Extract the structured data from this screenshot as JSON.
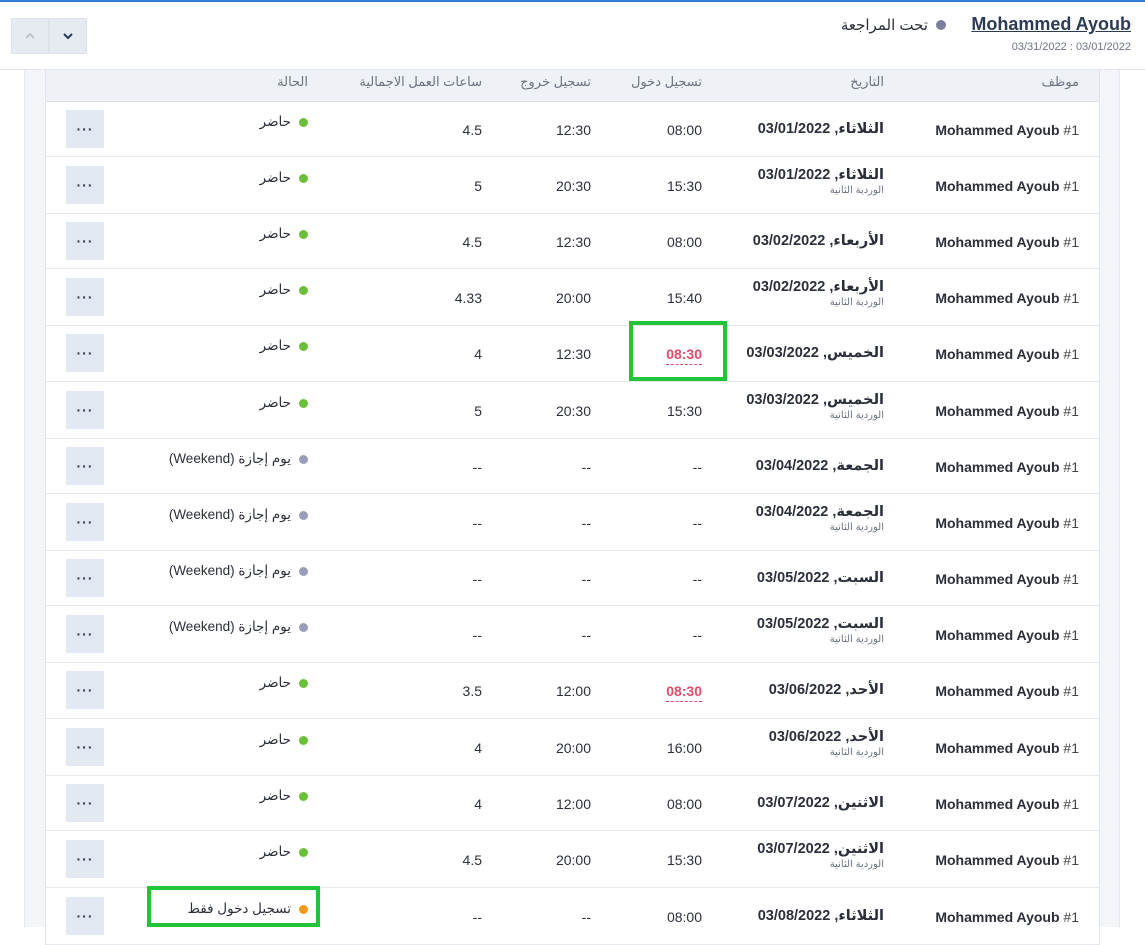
{
  "header": {
    "employee_name": "Mohammed Ayoub",
    "status_label": "تحت المراجعة",
    "date_range": "03/31/2022 : 03/01/2022",
    "status_dot_color": "#7b7f9e"
  },
  "table": {
    "columns": {
      "employee": "موظف",
      "date": "التاريخ",
      "clock_in": "تسجيل دخول",
      "clock_out": "تسجيل خروج",
      "total_hours": "ساعات العمل الاجمالية",
      "status": "الحالة"
    },
    "rows": [
      {
        "employee": "Mohammed Ayoub",
        "num": "#1",
        "date": "الثلاثاء, 03/01/2022",
        "shift": "",
        "clock_in": "08:00",
        "late": false,
        "clock_out": "12:30",
        "hours": "4.5",
        "status": "حاضر",
        "status_color": "#6abf3a"
      },
      {
        "employee": "Mohammed Ayoub",
        "num": "#1",
        "date": "الثلاثاء, 03/01/2022",
        "shift": "الوردية الثانية",
        "clock_in": "15:30",
        "late": false,
        "clock_out": "20:30",
        "hours": "5",
        "status": "حاضر",
        "status_color": "#6abf3a"
      },
      {
        "employee": "Mohammed Ayoub",
        "num": "#1",
        "date": "الأربعاء, 03/02/2022",
        "shift": "",
        "clock_in": "08:00",
        "late": false,
        "clock_out": "12:30",
        "hours": "4.5",
        "status": "حاضر",
        "status_color": "#6abf3a"
      },
      {
        "employee": "Mohammed Ayoub",
        "num": "#1",
        "date": "الأربعاء, 03/02/2022",
        "shift": "الوردية الثانية",
        "clock_in": "15:40",
        "late": false,
        "clock_out": "20:00",
        "hours": "4.33",
        "status": "حاضر",
        "status_color": "#6abf3a"
      },
      {
        "employee": "Mohammed Ayoub",
        "num": "#1",
        "date": "الخميس, 03/03/2022",
        "shift": "",
        "clock_in": "08:30",
        "late": true,
        "clock_out": "12:30",
        "hours": "4",
        "status": "حاضر",
        "status_color": "#6abf3a"
      },
      {
        "employee": "Mohammed Ayoub",
        "num": "#1",
        "date": "الخميس, 03/03/2022",
        "shift": "الوردية الثانية",
        "clock_in": "15:30",
        "late": false,
        "clock_out": "20:30",
        "hours": "5",
        "status": "حاضر",
        "status_color": "#6abf3a"
      },
      {
        "employee": "Mohammed Ayoub",
        "num": "#1",
        "date": "الجمعة, 03/04/2022",
        "shift": "",
        "clock_in": "--",
        "late": false,
        "clock_out": "--",
        "hours": "--",
        "status": "يوم إجازة (Weekend)",
        "status_color": "#9a9db5"
      },
      {
        "employee": "Mohammed Ayoub",
        "num": "#1",
        "date": "الجمعة, 03/04/2022",
        "shift": "الوردية الثانية",
        "clock_in": "--",
        "late": false,
        "clock_out": "--",
        "hours": "--",
        "status": "يوم إجازة (Weekend)",
        "status_color": "#9a9db5"
      },
      {
        "employee": "Mohammed Ayoub",
        "num": "#1",
        "date": "السبت, 03/05/2022",
        "shift": "",
        "clock_in": "--",
        "late": false,
        "clock_out": "--",
        "hours": "--",
        "status": "يوم إجازة (Weekend)",
        "status_color": "#9a9db5"
      },
      {
        "employee": "Mohammed Ayoub",
        "num": "#1",
        "date": "السبت, 03/05/2022",
        "shift": "الوردية الثانية",
        "clock_in": "--",
        "late": false,
        "clock_out": "--",
        "hours": "--",
        "status": "يوم إجازة (Weekend)",
        "status_color": "#9a9db5"
      },
      {
        "employee": "Mohammed Ayoub",
        "num": "#1",
        "date": "الأحد, 03/06/2022",
        "shift": "",
        "clock_in": "08:30",
        "late": true,
        "clock_out": "12:00",
        "hours": "3.5",
        "status": "حاضر",
        "status_color": "#6abf3a"
      },
      {
        "employee": "Mohammed Ayoub",
        "num": "#1",
        "date": "الأحد, 03/06/2022",
        "shift": "الوردية الثانية",
        "clock_in": "16:00",
        "late": false,
        "clock_out": "20:00",
        "hours": "4",
        "status": "حاضر",
        "status_color": "#6abf3a"
      },
      {
        "employee": "Mohammed Ayoub",
        "num": "#1",
        "date": "الاثنين, 03/07/2022",
        "shift": "",
        "clock_in": "08:00",
        "late": false,
        "clock_out": "12:00",
        "hours": "4",
        "status": "حاضر",
        "status_color": "#6abf3a"
      },
      {
        "employee": "Mohammed Ayoub",
        "num": "#1",
        "date": "الاثنين, 03/07/2022",
        "shift": "الوردية الثانية",
        "clock_in": "15:30",
        "late": false,
        "clock_out": "20:00",
        "hours": "4.5",
        "status": "حاضر",
        "status_color": "#6abf3a"
      },
      {
        "employee": "Mohammed Ayoub",
        "num": "#1",
        "date": "الثلاثاء, 03/08/2022",
        "shift": "",
        "clock_in": "08:00",
        "late": false,
        "clock_out": "--",
        "hours": "--",
        "status": "تسجيل دخول فقط",
        "status_color": "#f29a1a"
      }
    ],
    "row_menu_label": "···"
  },
  "colors": {
    "accent": "#2f80d1",
    "late_time": "#e24c6c",
    "highlight_box": "#22c53a"
  }
}
